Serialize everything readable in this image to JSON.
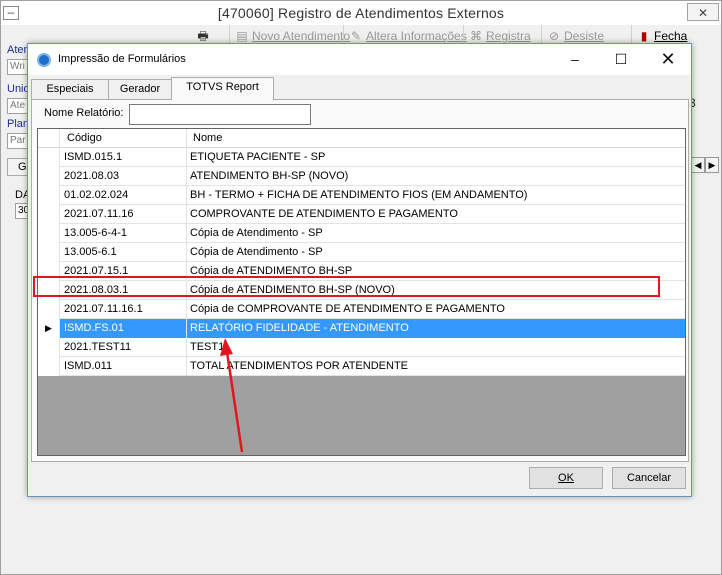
{
  "main_window": {
    "title": "[470060]  Registro de Atendimentos Externos",
    "toolbar": {
      "novo": "Novo Atendimento",
      "altera": "Altera Informações",
      "registra": "Registra",
      "desiste": "Desiste",
      "fecha": "Fecha"
    },
    "labels": {
      "aten": "Aten",
      "unid": "Unid",
      "plan": "Plan",
      "da": "DA",
      "gr": "Gr"
    },
    "inputs": {
      "aten": "Wri",
      "unid": "Ate",
      "plan": "Par",
      "da": "30"
    },
    "side_number": "3"
  },
  "dialog": {
    "title": "Impressão de Formulários",
    "tabs": [
      "Especiais",
      "Gerador",
      "TOTVS Report"
    ],
    "active_tab": "TOTVS Report",
    "nome_relatorio_label": "Nome Relatório:",
    "nome_relatorio_value": "",
    "grid": {
      "columns": [
        "Código",
        "Nome"
      ],
      "rows": [
        {
          "codigo": "ISMD.015.1",
          "nome": " ETIQUETA PACIENTE - SP"
        },
        {
          "codigo": "2021.08.03",
          "nome": "ATENDIMENTO BH-SP (NOVO)"
        },
        {
          "codigo": "01.02.02.024",
          "nome": "BH - TERMO + FICHA DE ATENDIMENTO FIOS (EM ANDAMENTO)"
        },
        {
          "codigo": "2021.07.11.16",
          "nome": "COMPROVANTE DE ATENDIMENTO E PAGAMENTO"
        },
        {
          "codigo": "13.005-6-4-1",
          "nome": "Cópia de Atendimento - SP"
        },
        {
          "codigo": "13.005-6.1",
          "nome": "Cópia de Atendimento - SP"
        },
        {
          "codigo": "2021.07.15.1",
          "nome": "Cópia de ATENDIMENTO BH-SP"
        },
        {
          "codigo": "2021.08.03.1",
          "nome": "Cópia de ATENDIMENTO BH-SP (NOVO)"
        },
        {
          "codigo": "2021.07.11.16.1",
          "nome": "Cópia de COMPROVANTE DE ATENDIMENTO E PAGAMENTO"
        },
        {
          "codigo": "ISMD.FS.01",
          "nome": "RELATÓRIO FIDELIDADE - ATENDIMENTO"
        },
        {
          "codigo": "2021.TEST11",
          "nome": "TEST11"
        },
        {
          "codigo": "ISMD.011",
          "nome": "TOTAL ATENDIMENTOS POR ATENDENTE"
        }
      ],
      "selected_index": 9
    },
    "buttons": {
      "ok": "OK",
      "cancel": "Cancelar"
    }
  },
  "colors": {
    "selection": "#3399ff",
    "annotation": "#e0171d",
    "grid_empty": "#a0a0a0"
  }
}
